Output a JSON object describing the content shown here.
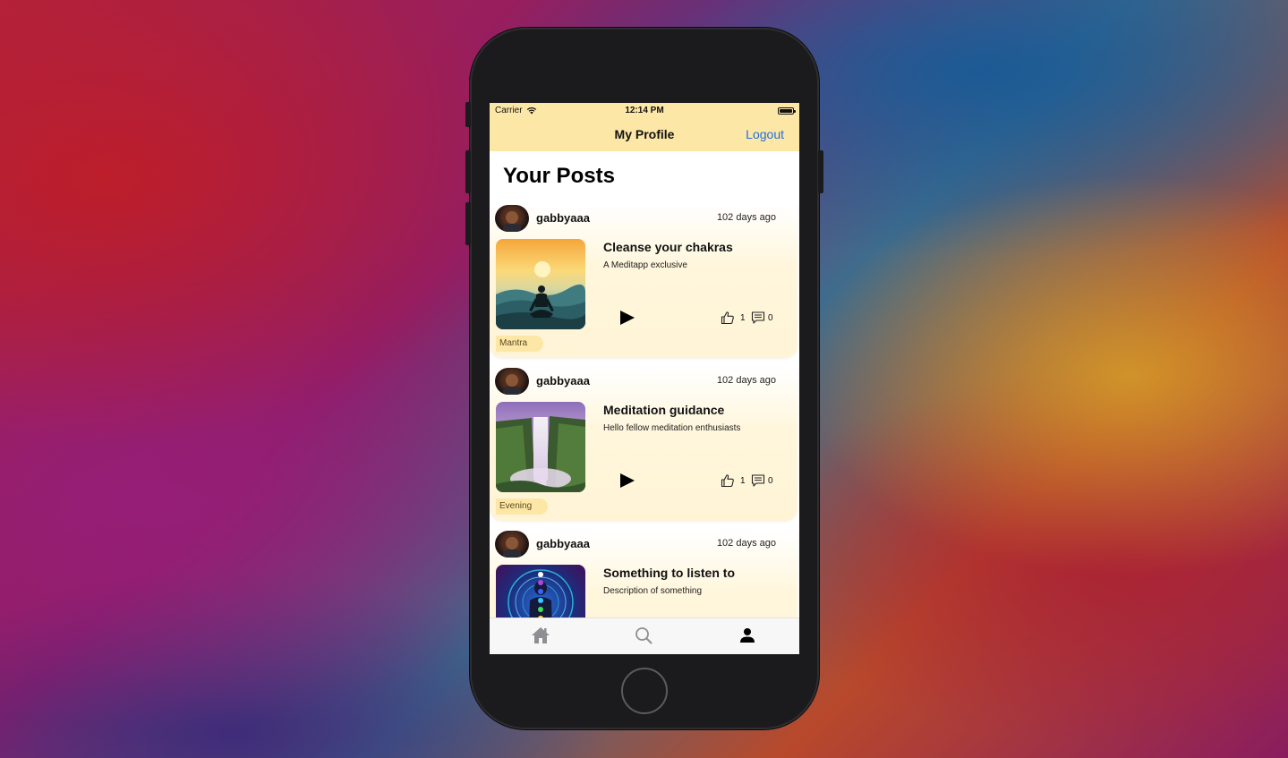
{
  "status_bar": {
    "carrier": "Carrier",
    "time": "12:14 PM"
  },
  "nav": {
    "title": "My Profile",
    "logout_label": "Logout"
  },
  "section": {
    "title": "Your Posts"
  },
  "posts": [
    {
      "username": "gabbyaaa",
      "time_ago": "102 days ago",
      "title": "Cleanse your chakras",
      "description": "A Meditapp exclusive",
      "likes": "1",
      "comments": "0",
      "tag": "Mantra"
    },
    {
      "username": "gabbyaaa",
      "time_ago": "102 days ago",
      "title": "Meditation guidance",
      "description": "Hello fellow meditation enthusiasts",
      "likes": "1",
      "comments": "0",
      "tag": "Evening"
    },
    {
      "username": "gabbyaaa",
      "time_ago": "102 days ago",
      "title": "Something to listen to",
      "description": "Description of something"
    }
  ],
  "tab_bar": {
    "items": [
      "home-icon",
      "search-icon",
      "person-icon"
    ],
    "active": "person-icon"
  },
  "colors": {
    "header_bg": "#fde7a6",
    "link": "#1f6fe0",
    "tag_bg": "#fde7a6"
  }
}
